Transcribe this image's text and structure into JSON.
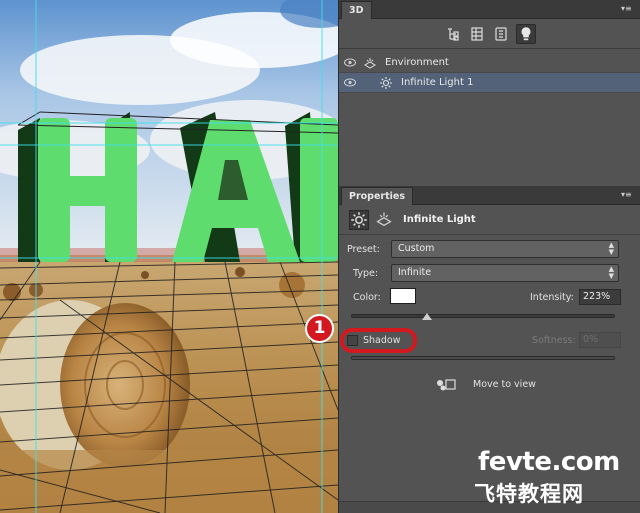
{
  "panel_3d": {
    "tab_label": "3D",
    "layers": [
      {
        "label": "Environment",
        "icon": "environment-icon",
        "selected": false
      },
      {
        "label": "Infinite Light 1",
        "icon": "infinite-light-icon",
        "selected": true
      }
    ],
    "toolbar_icons": [
      "scene-filter-icon",
      "mesh-filter-icon",
      "material-filter-icon",
      "light-filter-icon"
    ]
  },
  "properties": {
    "tab_label": "Properties",
    "title": "Infinite Light",
    "preset_label": "Preset:",
    "preset_value": "Custom",
    "type_label": "Type:",
    "type_value": "Infinite",
    "color_label": "Color:",
    "color_value": "#ffffff",
    "intensity_label": "Intensity:",
    "intensity_value": "223%",
    "shadow_label": "Shadow",
    "shadow_checked": false,
    "softness_label": "Softness:",
    "softness_value": "0%",
    "move_to_view_label": "Move to view"
  },
  "annotation": {
    "number": "1",
    "color": "#d31820"
  },
  "watermark": {
    "line1": "fevte.com",
    "line2": "飞特教程网"
  },
  "canvas": {
    "headline_text": "HAL",
    "letter_color": "#5fdc6e"
  }
}
